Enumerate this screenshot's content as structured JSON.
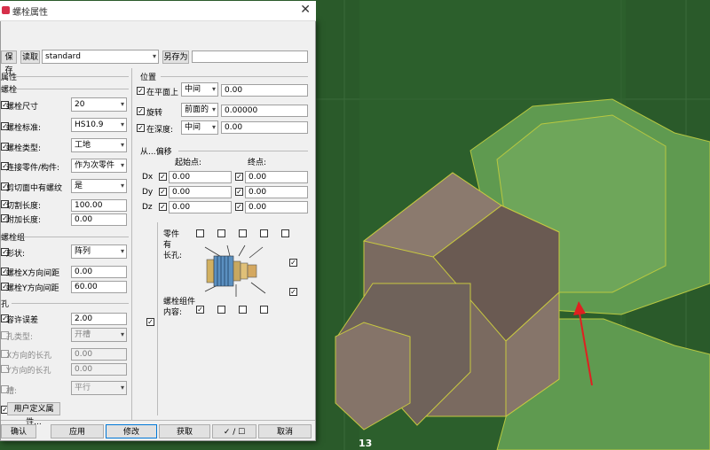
{
  "window": {
    "title": "螺栓属性"
  },
  "toolbar": {
    "save": "保存",
    "load": "读取",
    "preset": "standard",
    "saveas": "另存为",
    "saveas_value": ""
  },
  "attr": {
    "header": "属性",
    "bolt_section": "螺栓",
    "rows": [
      {
        "label": "螺栓尺寸",
        "value": "20"
      },
      {
        "label": "螺栓标准:",
        "value": "HS10.9"
      },
      {
        "label": "螺栓类型:",
        "value": "工地"
      },
      {
        "label": "连接零件/构件:",
        "value": "作为次零件"
      },
      {
        "label": "剪切面中有螺纹",
        "value": "是"
      }
    ],
    "cut_length": {
      "label": "切割长度:",
      "value": "100.00"
    },
    "extra_length": {
      "label": "附加长度:",
      "value": "0.00"
    }
  },
  "group": {
    "header": "螺栓组",
    "shape_label": "形状:",
    "shape_value": "阵列",
    "x_label": "螺栓X方向间距",
    "x_value": "0.00",
    "y_label": "螺栓Y方向间距",
    "y_value": "60.00"
  },
  "hole": {
    "header": "孔",
    "tol_label": "容许误差",
    "tol_value": "2.00",
    "type_label": "孔类型:",
    "type_value": "开槽",
    "xslot_label": "X方向的长孔",
    "xslot_value": "0.00",
    "yslot_label": "Y方向的长孔",
    "yslot_value": "0.00",
    "slot_label": "槽:",
    "slot_value": "平行"
  },
  "user_attr": "用户定义属性...",
  "position": {
    "header": "位置",
    "plane": {
      "label": "在平面上",
      "sel": "中间",
      "val": "0.00"
    },
    "rotate": {
      "label": "旋转",
      "sel": "前面的",
      "val": "0.00000"
    },
    "depth": {
      "label": "在深度:",
      "sel": "中间",
      "val": "0.00"
    }
  },
  "offset": {
    "header": "从...偏移",
    "start": "起始点:",
    "end": "终点:",
    "rows": [
      {
        "axis": "Dx",
        "s": "0.00",
        "e": "0.00"
      },
      {
        "axis": "Dy",
        "s": "0.00",
        "e": "0.00"
      },
      {
        "axis": "Dz",
        "s": "0.00",
        "e": "0.00"
      }
    ]
  },
  "assembly": {
    "part_label": "零件",
    "has_label": "有",
    "slot_label": "长孔:",
    "contents_label": "螺栓组件",
    "contents_sub": "内容:"
  },
  "footer": {
    "ok": "确认",
    "apply": "应用",
    "modify": "修改",
    "get": "获取",
    "toggle": "✓ / ☐",
    "cancel": "取消"
  },
  "viewport": {
    "grid_label": "13"
  }
}
